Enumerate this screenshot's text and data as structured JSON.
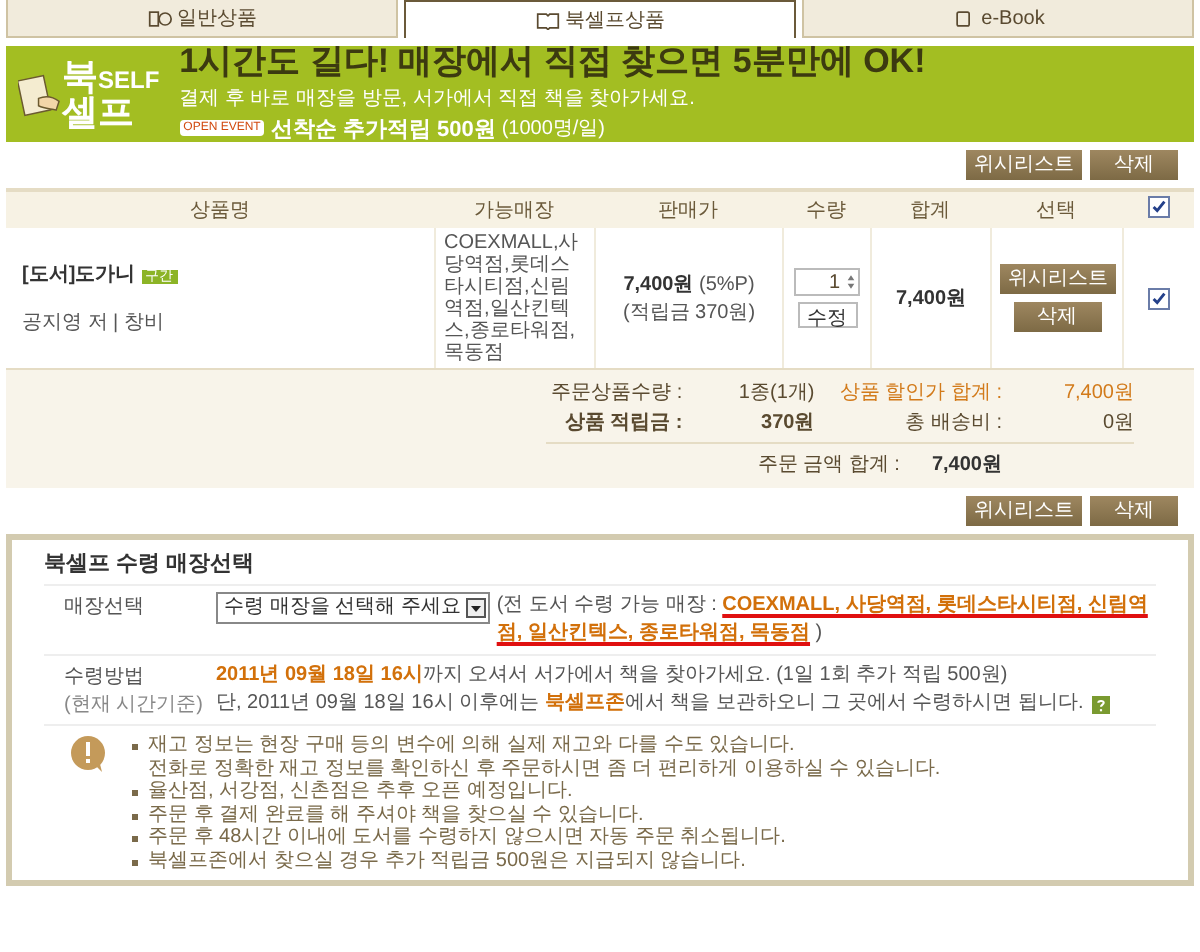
{
  "tabs": [
    {
      "label": "일반상품",
      "selected": false
    },
    {
      "label": "북셀프상품",
      "selected": true
    },
    {
      "label": "e-Book",
      "selected": false
    }
  ],
  "banner": {
    "logo": [
      "북",
      "SELF",
      "셀프"
    ],
    "headline": "1시간도 길다! 매장에서 직접 찾으면 5분만에 OK!",
    "subline": "결제 후 바로 매장을 방문, 서가에서 직접 책을 찾아가세요.",
    "badge": "OPEN EVENT",
    "event": "선착순 추가적립 500원",
    "event_note": "(1000명/일)"
  },
  "top_buttons": [
    "위시리스트",
    "삭제"
  ],
  "table": {
    "columns": [
      "상품명",
      "가능매장",
      "판매가",
      "수량",
      "합계",
      "선택"
    ],
    "all_checked": true,
    "rows": [
      {
        "title": "[도서]도가니",
        "badge": "구간",
        "author": "공지영 저 | 창비",
        "stores": "COEXMALL,사당역점,롯데스타시티점,신림역점,일산킨텍스,종로타워점,목동점",
        "price": "7,400원",
        "rate": "(5%P)",
        "points": "(적립금 370원)",
        "quantity": "1",
        "quantity_button": "수정",
        "total": "7,400원",
        "buttons": [
          "위시리스트",
          "삭제"
        ],
        "checked": true
      }
    ]
  },
  "summary": {
    "items": [
      {
        "label": "주문상품수량 :",
        "value": "1종(1개)",
        "kind": "plain"
      },
      {
        "label": "상품 할인가 합계 :",
        "value": "7,400원",
        "kind": "accent"
      },
      {
        "label": "상품 적립금 :",
        "value": "370원",
        "kind": "bold"
      },
      {
        "label": "총 배송비 :",
        "value": "0원",
        "kind": "plain"
      }
    ],
    "total_label": "주문 금액 합계 :",
    "total_value": "7,400원"
  },
  "bottom_buttons": [
    "위시리스트",
    "삭제"
  ],
  "pickup": {
    "title": "북셀프 수령 매장선택",
    "store_label": "매장선택",
    "select_value": "수령 매장을 선택해 주세요",
    "store_note": "(전 도서 수령 가능 매장 : **COEXMALL, 사당역점, 롯데스타시티점, 신림역점, 일산킨텍스, 종로타워점, 목동점** )",
    "method_label": "수령방법",
    "method_sublabel": "(현재 시간기준)",
    "method_lines": [
      "**2011년 09월 18일 16시**까지 오셔서 서가에서 책을 찾아가세요. (1일 1회 추가 적립 500원)",
      "단, 2011년 09월 18일 16시 이후에는 **북셀프존**에서 책을 보관하오니 그 곳에서 수령하시면 됩니다."
    ],
    "notes": [
      {
        "lines": [
          "재고 정보는 현장 구매 등의 변수에 의해 실제 재고와 다를 수도 있습니다.",
          "전화로 정확한 재고 정보를 확인하신 후 주문하시면 좀 더 편리하게 이용하실 수 있습니다."
        ]
      },
      {
        "lines": [
          "율산점, 서강점, 신촌점은 추후 오픈 예정입니다."
        ]
      },
      {
        "lines": [
          "주문 후 결제 완료를 해 주셔야 책을 찾으실 수 있습니다."
        ]
      },
      {
        "lines": [
          "주문 후 48시간 이내에 도서를 수령하지 않으시면 자동 주문 취소됩니다."
        ]
      },
      {
        "lines": [
          "북셀프존에서 찾으실 경우 추가 적립금 500원은 지급되지 않습니다."
        ]
      }
    ]
  }
}
